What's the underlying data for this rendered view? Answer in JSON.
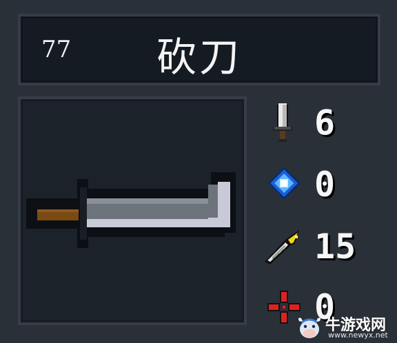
{
  "header": {
    "code": "77",
    "name": "砍刀"
  },
  "weapon": {
    "icon": "machete-sword-icon"
  },
  "stats": [
    {
      "icon": "sword-damage-icon",
      "value": "6"
    },
    {
      "icon": "energy-crystal-icon",
      "value": "0"
    },
    {
      "icon": "feather-critical-icon",
      "value": "15"
    },
    {
      "icon": "crosshair-spread-icon",
      "value": "0"
    }
  ],
  "watermark": {
    "title": "牛游戏网",
    "url": "www.newyx.net"
  },
  "colors": {
    "background": "#2a3038",
    "panel": "#151b22",
    "panel_border": "#363d47",
    "text": "#f4f4f4"
  }
}
